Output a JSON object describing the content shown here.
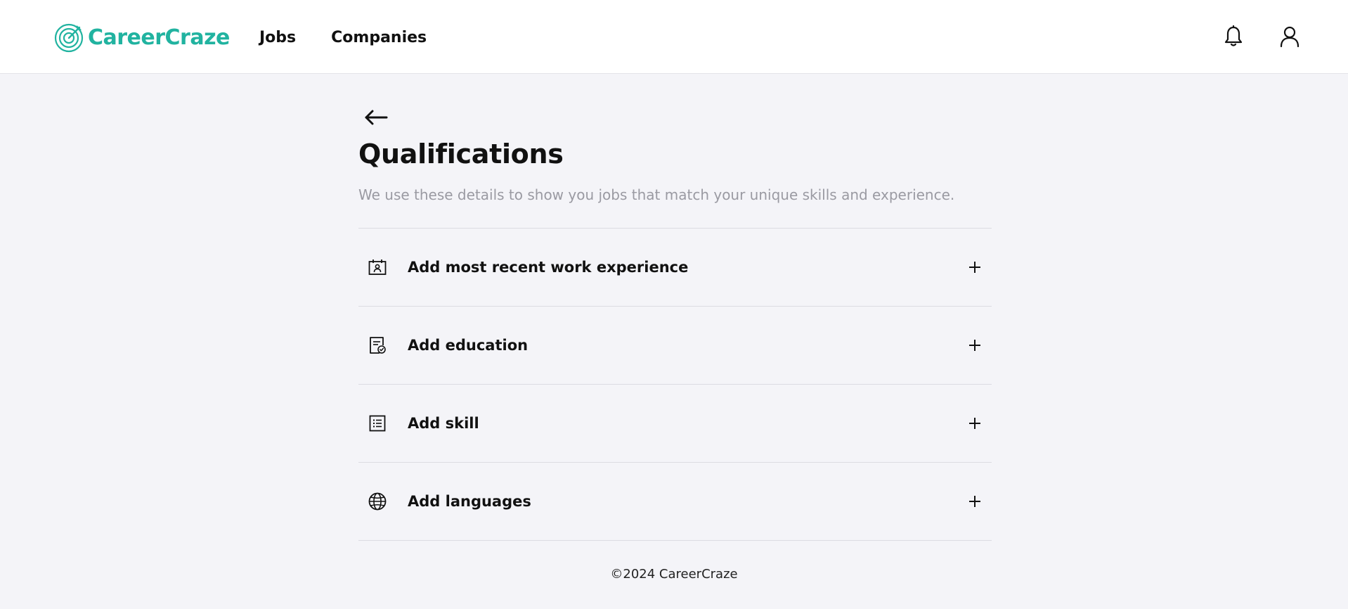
{
  "header": {
    "brand_name": "CareerCraze",
    "brand_color": "#21b3a0",
    "nav": [
      {
        "label": "Jobs"
      },
      {
        "label": "Companies"
      }
    ],
    "icons": [
      "bell-icon",
      "user-icon"
    ]
  },
  "page": {
    "back_icon": "arrow-left-icon",
    "title": "Qualifications",
    "subtitle": "We use these details to show you jobs that match your unique skills and experience."
  },
  "qualifications": [
    {
      "label": "Add most recent work experience",
      "icon": "work-experience-icon",
      "action_icon": "plus-icon"
    },
    {
      "label": "Add education",
      "icon": "education-certificate-icon",
      "action_icon": "plus-icon"
    },
    {
      "label": "Add skill",
      "icon": "skill-list-icon",
      "action_icon": "plus-icon"
    },
    {
      "label": "Add languages",
      "icon": "globe-icon",
      "action_icon": "plus-icon"
    }
  ],
  "footer": {
    "text": "©2024 CareerCraze"
  }
}
